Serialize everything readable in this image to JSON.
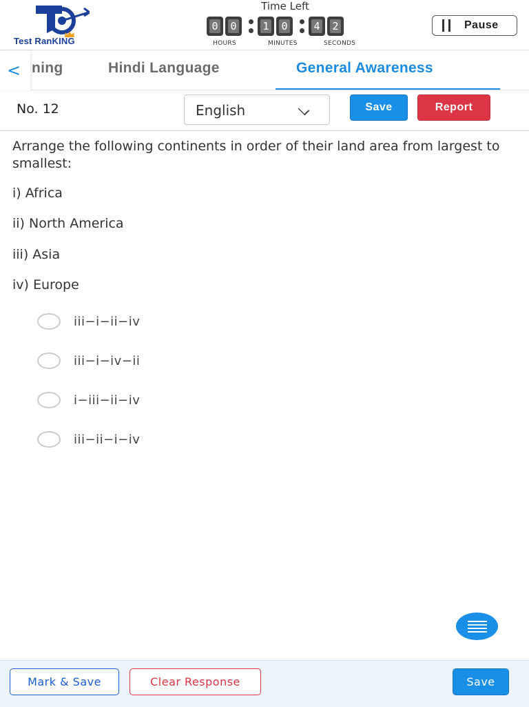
{
  "header": {
    "logo_text": "Test RanKING",
    "timer": {
      "title": "Time Left",
      "hours": [
        "0",
        "0"
      ],
      "minutes": [
        "1",
        "0"
      ],
      "seconds": [
        "4",
        "2"
      ],
      "hours_label": "HOURS",
      "minutes_label": "MINUTES",
      "seconds_label": "SECONDS"
    },
    "pause_label": "Pause"
  },
  "tabs": {
    "items": [
      {
        "label": "ning"
      },
      {
        "label": "Hindi Language"
      },
      {
        "label": "General Awareness"
      }
    ],
    "active_index": 2
  },
  "question_bar": {
    "number": "No. 12",
    "language": "English",
    "save_label": "Save",
    "report_label": "Report"
  },
  "question": {
    "text": "Arrange the following continents in order of their land area from largest to smallest:",
    "statements": [
      "i) Africa",
      "ii) North America",
      "iii) Asia",
      "iv) Europe"
    ],
    "options": [
      "iii−i−ii−iv",
      "iii−i−iv−ii",
      "i−iii−ii−iv",
      "iii−ii−i−iv"
    ]
  },
  "bottom_bar": {
    "mark_save_label": "Mark & Save",
    "clear_label": "Clear Response",
    "save_label": "Save"
  },
  "colors": {
    "accent": "#1a8fe8",
    "danger": "#dc3545",
    "brand": "#1b3f9a"
  }
}
